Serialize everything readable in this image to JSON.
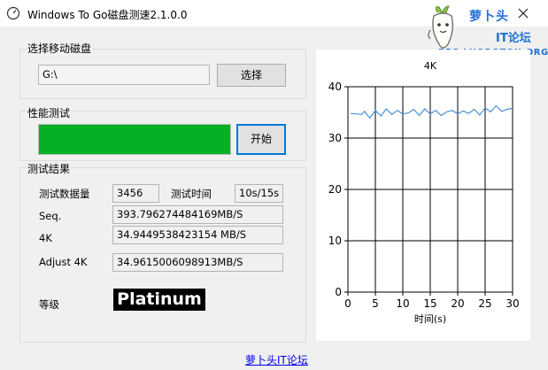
{
  "window": {
    "title": "Windows To Go磁盘测速2.1.0.0"
  },
  "logo": {
    "brand": "萝卜头",
    "it": "IT论坛",
    "url": "BBS.LUOBOTOU.ORG"
  },
  "disk_group": {
    "title": "选择移动磁盘",
    "drive_value": "G:\\",
    "select_label": "选择"
  },
  "perf_group": {
    "title": "性能测试",
    "progress": 1.0,
    "start_label": "开始"
  },
  "results": {
    "title": "测试结果",
    "data_size_label": "测试数据量",
    "data_size_value": "3456",
    "time_label": "测试时间",
    "time_value": "10s/15s",
    "seq_label": "Seq.",
    "seq_value": "393.796274484169MB/S",
    "k4_label": "4K",
    "k4_value": "34.9449538423154 MB/S",
    "adjust_label": "Adjust 4K",
    "adjust_value": "34.9615006098913MB/S",
    "grade_label": "等级",
    "grade_value": "Platinum"
  },
  "footer": {
    "link": "萝卜头IT论坛"
  },
  "colors": {
    "progress": "#06b025",
    "line": "#4a90d9"
  },
  "chart_data": {
    "type": "line",
    "title": "4K",
    "xlabel": "时间(s)",
    "ylabel": "",
    "xlim": [
      0,
      30
    ],
    "ylim": [
      0,
      40
    ],
    "xticks": [
      0,
      5,
      10,
      15,
      20,
      25,
      30
    ],
    "yticks": [
      0,
      10,
      20,
      30,
      40
    ],
    "grid": true,
    "series": [
      {
        "x": [
          0.5,
          1.5,
          2.5,
          3.0,
          4.0,
          5.0,
          6.0,
          7.0,
          8.0,
          9.0,
          10.0,
          11.0,
          12.0,
          13.0,
          14.0,
          15.0,
          16.0,
          17.0,
          18.0,
          19.0,
          20.0,
          21.0,
          22.0,
          23.0,
          24.0,
          25.0,
          26.0,
          27.0,
          28.0,
          29.0,
          30.0
        ],
        "y": [
          34.8,
          34.7,
          34.6,
          35.2,
          33.9,
          35.4,
          34.3,
          35.7,
          34.6,
          35.4,
          34.7,
          34.9,
          35.6,
          34.4,
          35.7,
          34.7,
          35.4,
          34.4,
          35.1,
          35.4,
          34.7,
          35.3,
          34.8,
          35.6,
          34.5,
          35.9,
          35.1,
          36.3,
          35.2,
          35.6,
          35.8
        ]
      }
    ]
  }
}
